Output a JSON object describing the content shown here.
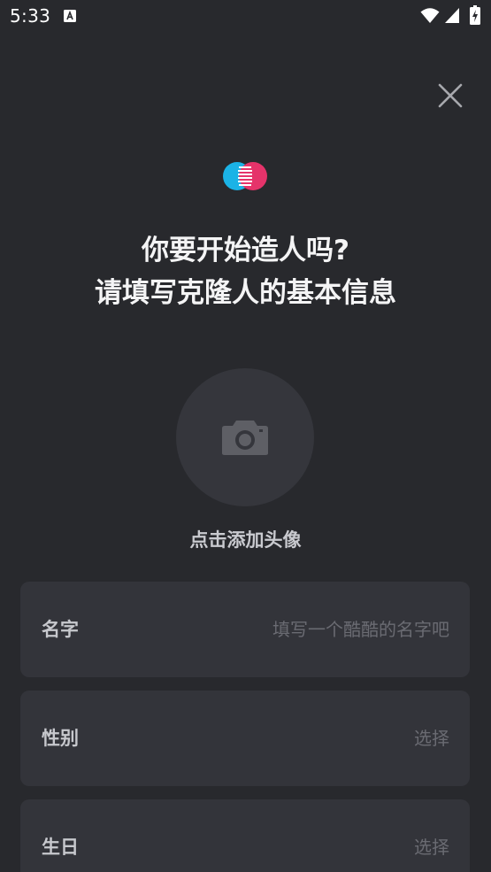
{
  "status_bar": {
    "time": "5:33",
    "icons": [
      "notification-a-icon",
      "wifi-icon",
      "cell-signal-icon",
      "battery-charging-icon"
    ]
  },
  "header": {
    "close_icon": "close-icon"
  },
  "logo": {
    "icon": "app-logo",
    "colors": {
      "left": "#1bb3e6",
      "right": "#e5336a"
    }
  },
  "headline": {
    "line1": "你要开始造人吗?",
    "line2": "请填写克隆人的基本信息"
  },
  "avatar": {
    "icon": "camera-icon",
    "label": "点击添加头像"
  },
  "form": {
    "fields": [
      {
        "label": "名字",
        "placeholder": "填写一个酷酷的名字吧"
      },
      {
        "label": "性别",
        "placeholder": "选择"
      },
      {
        "label": "生日",
        "placeholder": "选择"
      }
    ]
  },
  "colors": {
    "background": "#28292d",
    "card": "#33343a",
    "avatar_circle": "#35363c",
    "placeholder_text": "#6a6b72"
  }
}
